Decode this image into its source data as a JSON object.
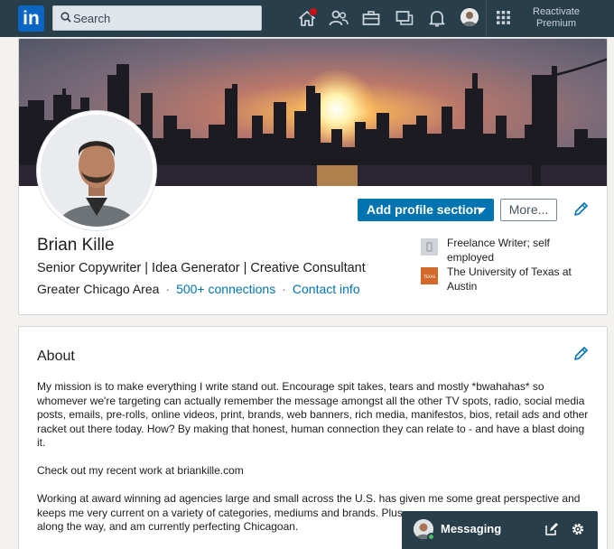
{
  "nav": {
    "logo": "in",
    "search_placeholder": "Search",
    "premium_line1": "Reactivate",
    "premium_line2": "Premium",
    "icons": [
      "home-icon",
      "my-network-icon",
      "jobs-icon",
      "messaging-icon",
      "notifications-icon",
      "me-avatar",
      "work-grid-icon"
    ]
  },
  "profile": {
    "name": "Brian Kille",
    "headline": "Senior Copywriter | Idea Generator | Creative Consultant",
    "location": "Greater Chicago Area",
    "connections": "500+ connections",
    "contact": "Contact info",
    "add_section": "Add profile section",
    "more": "More...",
    "experience": "Freelance Writer; self employed",
    "education": "The University of Texas at Austin",
    "education_logo_text": "TEXAS"
  },
  "about": {
    "title": "About",
    "p1": "My mission is to make everything I write stand out. Encourage spit takes, tears and mostly *bwahahas* so whomever we're targeting can actually remember the message amongst all the other TV spots, radio, social media posts, emails, pre-rolls, online videos, print, brands, web banners, rich media, manifestos, bios, retail ads and other racket out there today. How? By making that honest, human connection they can relate to - and have a blast doing it.",
    "p2": "Check out my recent work at briankille.com",
    "p3a": "Working at award winning ad agencies large and small across the U.S. has given me some great perspective and keeps me very current on a variety of categories, mediums and brands. Plus",
    "p3b": "along the way, and am currently perfecting Chicagoan."
  },
  "messaging": {
    "label": "Messaging"
  },
  "colors": {
    "nav_bg": "#283e4a",
    "accent": "#0073b1",
    "page_bg": "#f3f2ef"
  }
}
